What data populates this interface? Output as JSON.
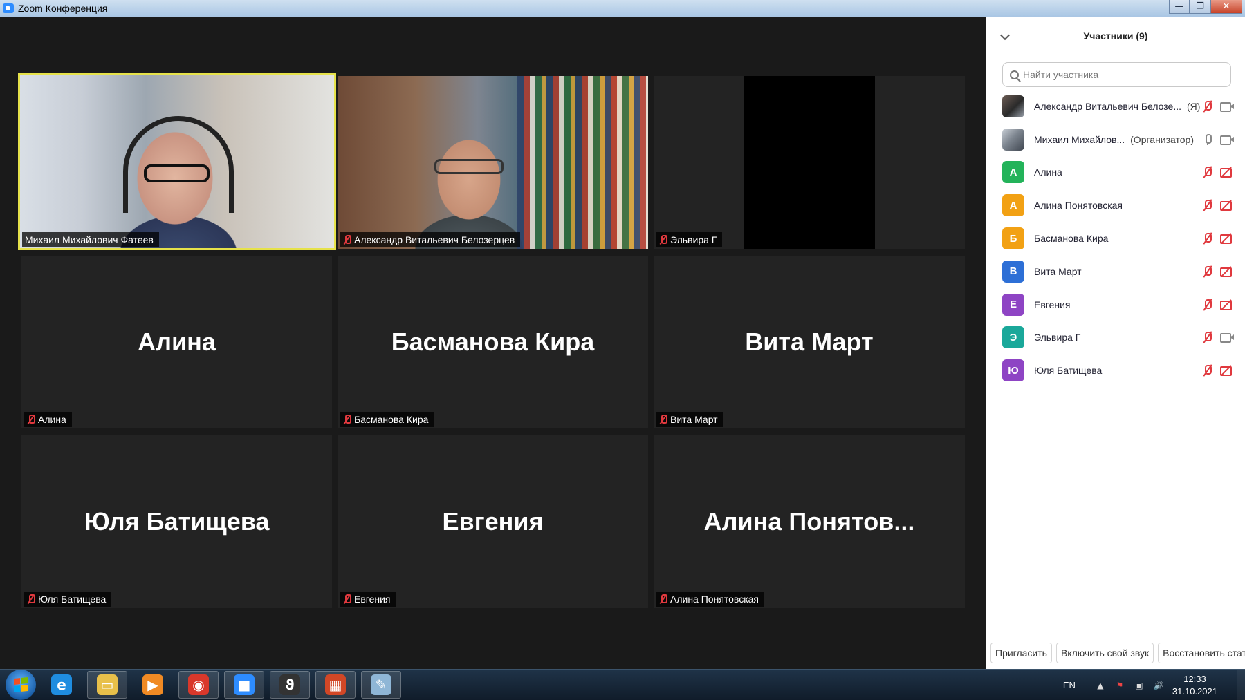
{
  "window": {
    "title": "Zoom Конференция",
    "controls": {
      "minimize": "—",
      "maximize": "❐",
      "close": "✕"
    }
  },
  "tiles": [
    {
      "label": "Михаил Михайлович Фатеев",
      "center_name": "",
      "muted": false,
      "video": true,
      "active": true
    },
    {
      "label": "Александр Витальевич Белозерцев",
      "center_name": "",
      "muted": true,
      "video": true,
      "active": false
    },
    {
      "label": "Эльвира Г",
      "center_name": "",
      "muted": true,
      "video": true,
      "active": false
    },
    {
      "label": "Алина",
      "center_name": "Алина",
      "muted": true,
      "video": false,
      "active": false
    },
    {
      "label": "Басманова Кира",
      "center_name": "Басманова Кира",
      "muted": true,
      "video": false,
      "active": false
    },
    {
      "label": "Вита Март",
      "center_name": "Вита Март",
      "muted": true,
      "video": false,
      "active": false
    },
    {
      "label": "Юля Батищева",
      "center_name": "Юля Батищева",
      "muted": true,
      "video": false,
      "active": false
    },
    {
      "label": "Евгения",
      "center_name": "Евгения",
      "muted": true,
      "video": false,
      "active": false
    },
    {
      "label": "Алина Понятовская",
      "center_name": "Алина  Понятов...",
      "muted": true,
      "video": false,
      "active": false
    }
  ],
  "panel": {
    "title": "Участники (9)",
    "search_placeholder": "Найти участника",
    "participants": [
      {
        "name": "Александр Витальевич Белозе...",
        "role": "(Я)",
        "avatar_letter": "",
        "avatar_color": "",
        "mic": "off",
        "cam": "on"
      },
      {
        "name": "Михаил Михайлов...",
        "role": "(Организатор)",
        "avatar_letter": "",
        "avatar_color": "",
        "mic": "on",
        "cam": "on"
      },
      {
        "name": "Алина",
        "role": "",
        "avatar_letter": "А",
        "avatar_color": "#23b35a",
        "mic": "off",
        "cam": "off"
      },
      {
        "name": "Алина Понятовская",
        "role": "",
        "avatar_letter": "А",
        "avatar_color": "#f2a114",
        "mic": "off",
        "cam": "off"
      },
      {
        "name": "Басманова Кира",
        "role": "",
        "avatar_letter": "Б",
        "avatar_color": "#f2a114",
        "mic": "off",
        "cam": "off"
      },
      {
        "name": "Вита Март",
        "role": "",
        "avatar_letter": "В",
        "avatar_color": "#2d6fd6",
        "mic": "off",
        "cam": "off"
      },
      {
        "name": "Евгения",
        "role": "",
        "avatar_letter": "Е",
        "avatar_color": "#8e44c4",
        "mic": "off",
        "cam": "off"
      },
      {
        "name": "Эльвира Г",
        "role": "",
        "avatar_letter": "Э",
        "avatar_color": "#1aa89a",
        "mic": "off",
        "cam": "on"
      },
      {
        "name": "Юля Батищева",
        "role": "",
        "avatar_letter": "Ю",
        "avatar_color": "#8e44c4",
        "mic": "off",
        "cam": "off"
      }
    ],
    "footer": {
      "invite": "Пригласить",
      "unmute": "Включить свой звук",
      "restore": "Восстановить стату"
    }
  },
  "taskbar": {
    "apps": [
      {
        "name": "ie",
        "glyph": "e",
        "color": "#1f8de0",
        "boxed": false
      },
      {
        "name": "explorer",
        "glyph": "▭",
        "color": "#e8c04a",
        "boxed": true
      },
      {
        "name": "media-player",
        "glyph": "▶",
        "color": "#f08a24",
        "boxed": false
      },
      {
        "name": "chrome",
        "glyph": "◉",
        "color": "#d9382b",
        "boxed": true
      },
      {
        "name": "zoom",
        "glyph": "■",
        "color": "#2d8cff",
        "boxed": true
      },
      {
        "name": "app-b",
        "glyph": "ϑ",
        "color": "#333333",
        "boxed": true
      },
      {
        "name": "presentation",
        "glyph": "▦",
        "color": "#d24726",
        "boxed": true
      },
      {
        "name": "paint",
        "glyph": "✎",
        "color": "#8fb6d6",
        "boxed": true
      }
    ],
    "tray": {
      "lang": "EN",
      "time": "12:33",
      "date": "31.10.2021"
    }
  }
}
